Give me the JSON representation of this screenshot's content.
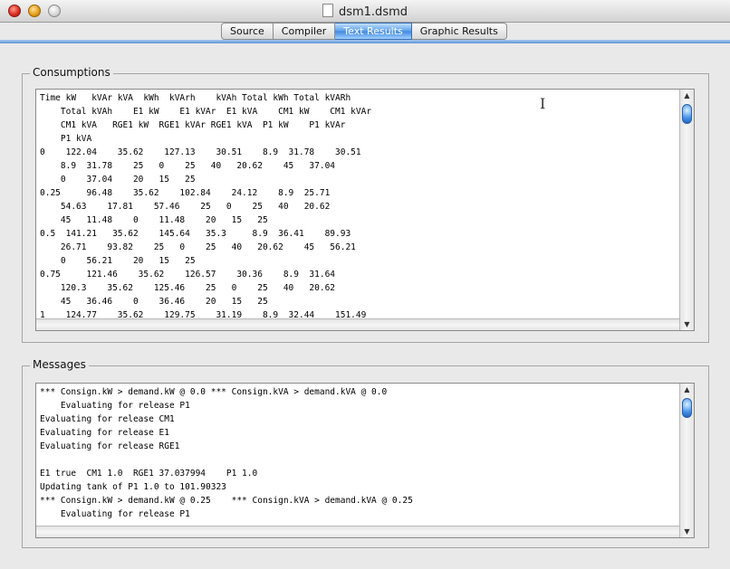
{
  "window": {
    "title": "dsm1.dsmd"
  },
  "tabs": [
    {
      "label": "Source"
    },
    {
      "label": "Compiler"
    },
    {
      "label": "Text Results",
      "active": true
    },
    {
      "label": "Graphic Results"
    }
  ],
  "consumptions": {
    "label": "Consumptions",
    "text": "Time kW   kVAr kVA  kWh  kVArh    kVAh Total kWh Total kVARh\n    Total kVAh    E1 kW    E1 kVAr  E1 kVA    CM1 kW    CM1 kVAr\n    CM1 kVA   RGE1 kW  RGE1 kVAr RGE1 kVA  P1 kW    P1 kVAr\n    P1 kVA\n0    122.04    35.62    127.13    30.51    8.9  31.78    30.51\n    8.9  31.78    25   0    25   40   20.62    45   37.04\n    0    37.04    20   15   25\n0.25     96.48    35.62    102.84    24.12    8.9  25.71\n    54.63    17.81    57.46    25   0    25   40   20.62\n    45   11.48    0    11.48    20   15   25\n0.5  141.21   35.62    145.64   35.3     8.9  36.41    89.93\n    26.71    93.82    25   0    25   40   20.62    45   56.21\n    0    56.21    20   15   25\n0.75     121.46    35.62    126.57    30.36    8.9  31.64\n    120.3    35.62    125.46    25   0    25   40   20.62\n    45   36.46    0    36.46    20   15   25\n1    124.77    35.62    129.75    31.19    8.9  32.44    151.49"
  },
  "messages": {
    "label": "Messages",
    "text": "*** Consign.kW > demand.kW @ 0.0 *** Consign.kVA > demand.kVA @ 0.0\n    Evaluating for release P1\nEvaluating for release CM1\nEvaluating for release E1\nEvaluating for release RGE1\n\nE1 true  CM1 1.0  RGE1 37.037994    P1 1.0\nUpdating tank of P1 1.0 to 101.90323\n*** Consign.kW > demand.kW @ 0.25    *** Consign.kVA > demand.kVA @ 0.25\n    Evaluating for release P1"
  },
  "icons": [
    "close-icon",
    "minimize-icon",
    "zoom-icon",
    "document-icon",
    "scroll-up-icon",
    "scroll-down-icon",
    "text-cursor-icon"
  ]
}
